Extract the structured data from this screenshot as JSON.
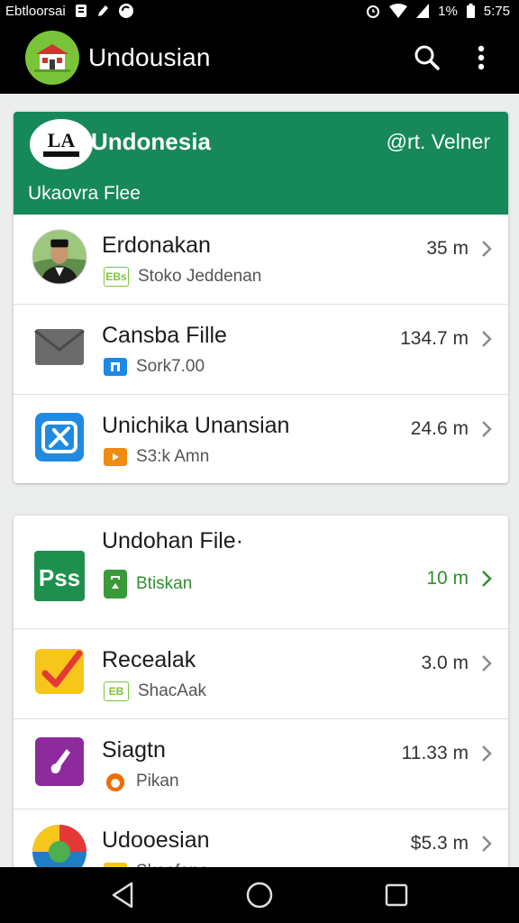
{
  "status_bar": {
    "carrier": "Ebtloorsai",
    "battery_text": "1%",
    "time": "5:75"
  },
  "app_bar": {
    "title": "Undousian",
    "logo_color": "#7ac43a",
    "actions": [
      "search-icon",
      "more-vert-icon"
    ]
  },
  "card1": {
    "header": {
      "badge_text": "LA",
      "title": "Undonesia",
      "meta": "@rt.  Velner",
      "subtitle": "Ukaovra Flee",
      "color": "#16885a"
    },
    "items": [
      {
        "title": "Erdonakan",
        "sub_badge": "EBs",
        "subtitle": "Stoko Jeddenan",
        "size": "35 m"
      },
      {
        "title": "Cansba Fille",
        "subtitle": "Sork7.00",
        "size": "134.7 m"
      },
      {
        "title": "Unichika Unansian",
        "subtitle": "S3:k Amn",
        "size": "24.6 m"
      }
    ]
  },
  "card2": {
    "items": [
      {
        "title": "Undohan File·",
        "icon_text": "Pss",
        "subtitle": "Btiskan",
        "size": "10 m"
      },
      {
        "title": "Recealak",
        "sub_badge": "EB",
        "subtitle": "ShacAak",
        "size": "3.0 m"
      },
      {
        "title": "Siagtn",
        "subtitle": "Pikan",
        "size": "11.33 m"
      },
      {
        "title": "Udooesian",
        "subtitle": "Skoofano",
        "size": "$5.3 m"
      }
    ]
  }
}
